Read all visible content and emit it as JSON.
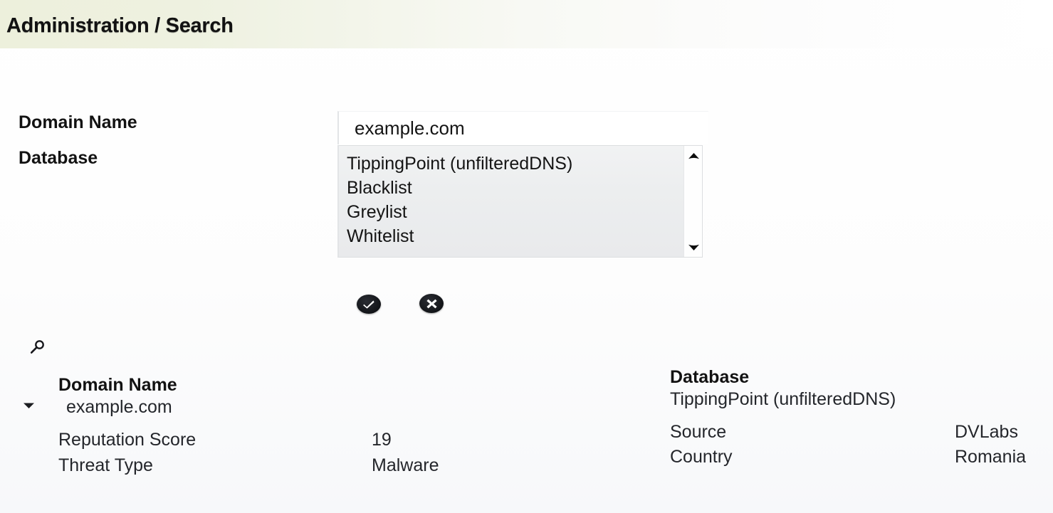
{
  "header": {
    "title": "Administration / Search",
    "band_color": "#edf0dc"
  },
  "form": {
    "domain_name_label": "Domain Name",
    "database_label": "Database",
    "domain_input": {
      "value": "example.com",
      "placeholder": "example.com"
    },
    "database_options": [
      "TippingPoint (unfilteredDNS)",
      "Blacklist",
      "Greylist",
      "Whitelist"
    ]
  },
  "actions": {
    "accept_icon": "check-circle-icon",
    "cancel_icon": "x-circle-icon"
  },
  "results": {
    "search_icon": "magnifier-icon",
    "expander_icon": "triangle-down-icon",
    "left": {
      "heading": "Domain Name",
      "value": "example.com",
      "rows": [
        {
          "key": "Reputation Score",
          "value": "19"
        },
        {
          "key": "Threat Type",
          "value": "Malware"
        }
      ]
    },
    "right": {
      "heading": "Database",
      "value": "TippingPoint (unfilteredDNS)",
      "rows": [
        {
          "key": "Source",
          "value": "DVLabs"
        },
        {
          "key": "Country",
          "value": "Romania"
        }
      ]
    }
  }
}
